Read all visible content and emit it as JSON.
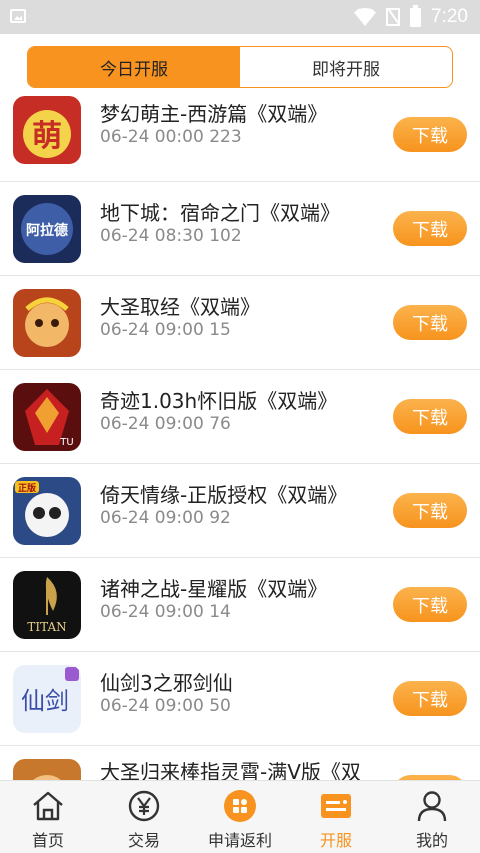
{
  "status_bar": {
    "time": "7:20"
  },
  "tabs": [
    {
      "label": "今日开服",
      "active": true
    },
    {
      "label": "即将开服",
      "active": false
    }
  ],
  "games": [
    {
      "name": "梦幻萌主-西游篇《双端》",
      "date": "06-24 00:00",
      "server": "223",
      "download_label": "下载",
      "icon": "cute-character-icon",
      "icon_color": "#d23a2a"
    },
    {
      "name": "地下城：宿命之门《双端》",
      "date": "06-24 08:30",
      "server": "102",
      "download_label": "下载",
      "icon": "dungeon-emblem-icon",
      "icon_color": "#2b3f7a"
    },
    {
      "name": "大圣取经《双端》",
      "date": "06-24 09:00",
      "server": "15",
      "download_label": "下载",
      "icon": "monkey-king-icon",
      "icon_color": "#c8782c"
    },
    {
      "name": "奇迹1.03h怀旧版《双端》",
      "date": "06-24 09:00",
      "server": "76",
      "download_label": "下载",
      "icon": "armored-warrior-icon",
      "icon_color": "#9a1c1c"
    },
    {
      "name": "倚天情缘-正版授权《双端》",
      "date": "06-24 09:00",
      "server": "92",
      "download_label": "下载",
      "icon": "panda-warrior-icon",
      "icon_color": "#3a5a9a"
    },
    {
      "name": "诸神之战-星耀版《双端》",
      "date": "06-24 09:00",
      "server": "14",
      "download_label": "下载",
      "icon": "titan-emblem-icon",
      "icon_color": "#1a1a1a"
    },
    {
      "name": "仙剑3之邪剑仙",
      "date": "06-24 09:00",
      "server": "50",
      "download_label": "下载",
      "icon": "xianjian-logo-icon",
      "icon_color": "#e8eef8"
    },
    {
      "name": "大圣归来棒指灵霄-满V版《双",
      "date": "",
      "server": "",
      "download_label": "下载",
      "icon": "monkey-king-icon",
      "icon_color": "#c8782c"
    }
  ],
  "icon_text": {
    "meng": "萌",
    "dungeon": "阿拉德",
    "titan": "TITAN",
    "xian": "仙剑",
    "tu": "TU",
    "zheng": "正版"
  },
  "nav": [
    {
      "label": "首页",
      "icon": "home-icon",
      "active": false
    },
    {
      "label": "交易",
      "icon": "yen-coin-icon",
      "active": false
    },
    {
      "label": "申请返利",
      "icon": "rebate-apps-icon",
      "active": false
    },
    {
      "label": "开服",
      "icon": "server-card-icon",
      "active": true
    },
    {
      "label": "我的",
      "icon": "user-icon",
      "active": false
    }
  ],
  "colors": {
    "accent": "#f7931e",
    "status_bar": "#dcdcdc"
  }
}
